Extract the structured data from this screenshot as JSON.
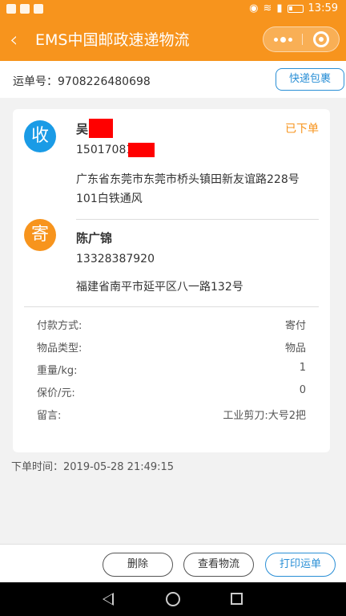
{
  "status_bar": {
    "time": "13:59"
  },
  "nav": {
    "title": "EMS中国邮政速递物流",
    "back_glyph": "‹"
  },
  "order": {
    "label": "运单号：9708226480698",
    "express_button": "快递包裹"
  },
  "receiver": {
    "avatar_char": "收",
    "name": "吴",
    "phone": "15017081",
    "address": "广东省东莞市东莞市桥头镇田新友谊路228号101白铁通风",
    "status": "已下单"
  },
  "sender": {
    "avatar_char": "寄",
    "name": "陈广锦",
    "phone": "13328387920",
    "address": "福建省南平市延平区八一路132号"
  },
  "details": [
    {
      "key": "付款方式:",
      "value": "寄付"
    },
    {
      "key": "物品类型:",
      "value": "物品"
    },
    {
      "key": "重量/kg:",
      "value": "1"
    },
    {
      "key": "保价/元:",
      "value": "0"
    },
    {
      "key": "留言:",
      "value": "工业剪刀:大号2把"
    }
  ],
  "order_time": "下单时间：2019-05-28 21:49:15",
  "actions": {
    "delete": "删除",
    "track": "查看物流",
    "print": "打印运单"
  },
  "colors": {
    "accent": "#f7941d",
    "blue": "#2a8fd6",
    "redaction": "#ff0000"
  }
}
